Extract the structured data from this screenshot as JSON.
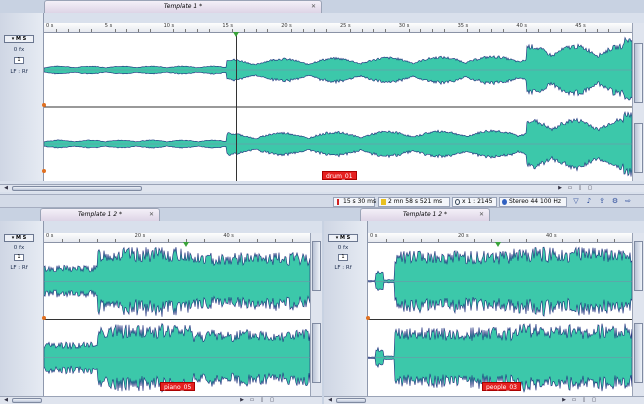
{
  "top_window": {
    "tab_title": "Template 1 *",
    "clip_name": "drum_01",
    "ruler_ticks": [
      "0 s",
      "5 s",
      "10 s",
      "15 s",
      "20 s",
      "25 s",
      "30 s",
      "35 s",
      "40 s",
      "45 s"
    ],
    "track": {
      "ms_label": "▾ M S",
      "fx": "0 fx",
      "channel": "1",
      "route": "LF : Rf"
    }
  },
  "status_bar": {
    "position": "15 s 30 ms",
    "length": "2 mn 58 s 521 ms",
    "zoom": "x 1 : 2145",
    "format": "Stereo 44 100 Hz"
  },
  "bottom_left_window": {
    "tab_title": "Template 1 2 *",
    "clip_name": "piano_05",
    "ruler_ticks": [
      "0 s",
      "20 s",
      "40 s"
    ],
    "track": {
      "ms_label": "▾ M S",
      "fx": "0 fx",
      "channel": "1",
      "route": "LF : Rf"
    }
  },
  "bottom_right_window": {
    "tab_title": "Template 1 2 *",
    "clip_name": "people_03",
    "ruler_ticks": [
      "0 s",
      "20 s",
      "40 s"
    ],
    "track": {
      "ms_label": "▾ M S",
      "fx": "0 fx",
      "channel": "1",
      "route": "LF : Rf"
    }
  },
  "colors": {
    "wave_fill": "#3cc8aa",
    "wave_edge": "#1b2a7a",
    "clip_label": "#e62020"
  },
  "icons": [
    "close-icon",
    "timer-icon",
    "length-icon",
    "zoom-icon",
    "stereo-icon",
    "filter-icon",
    "music-icon",
    "export-icon",
    "arrow-icon",
    "scroll-left-icon",
    "scroll-right-icon"
  ]
}
